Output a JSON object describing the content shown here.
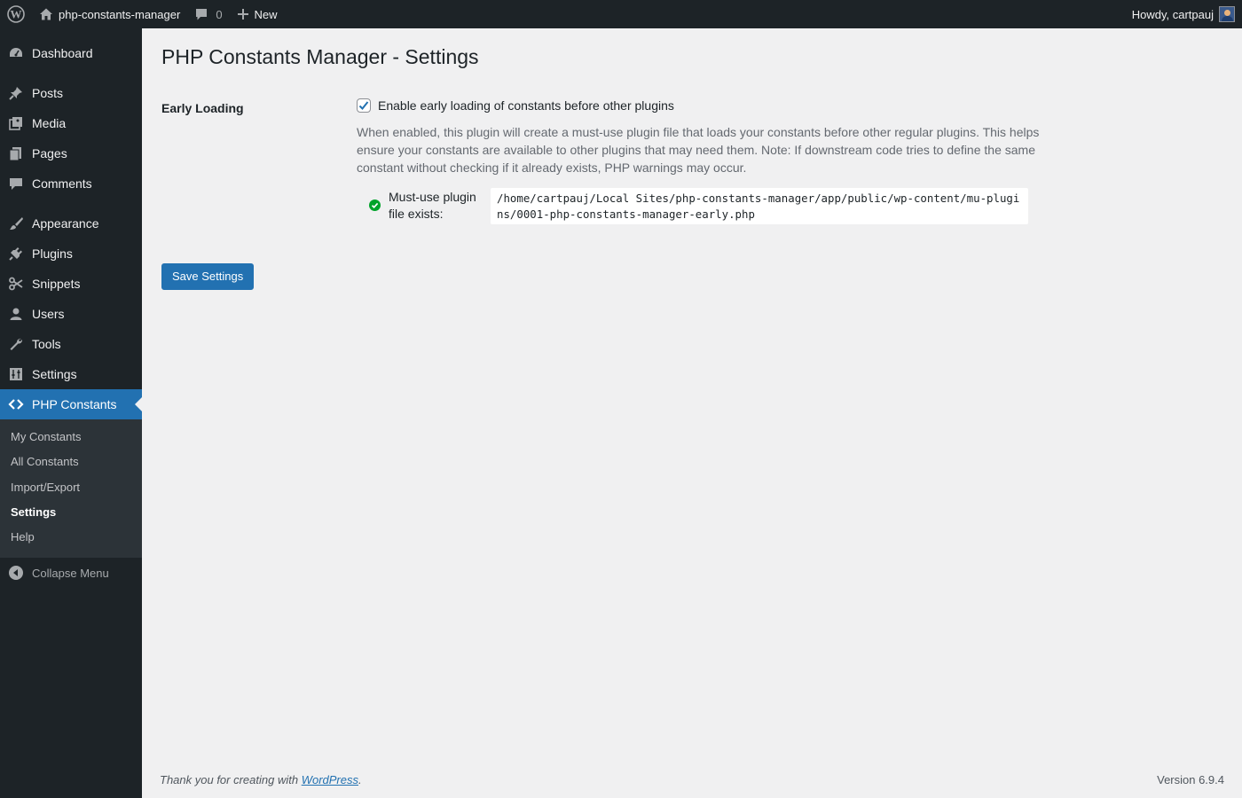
{
  "adminbar": {
    "site_name": "php-constants-manager",
    "comments_count": "0",
    "new_label": "New",
    "howdy": "Howdy, cartpauj"
  },
  "sidebar": {
    "items": [
      {
        "label": "Dashboard",
        "icon": "dashboard-icon"
      },
      {
        "label": "Posts",
        "icon": "pin-icon"
      },
      {
        "label": "Media",
        "icon": "media-icon"
      },
      {
        "label": "Pages",
        "icon": "pages-icon"
      },
      {
        "label": "Comments",
        "icon": "comment-icon"
      },
      {
        "label": "Appearance",
        "icon": "brush-icon"
      },
      {
        "label": "Plugins",
        "icon": "plug-icon"
      },
      {
        "label": "Snippets",
        "icon": "scissors-icon"
      },
      {
        "label": "Users",
        "icon": "user-icon"
      },
      {
        "label": "Tools",
        "icon": "wrench-icon"
      },
      {
        "label": "Settings",
        "icon": "sliders-icon"
      },
      {
        "label": "PHP Constants",
        "icon": "code-icon"
      }
    ],
    "submenu": [
      "My Constants",
      "All Constants",
      "Import/Export",
      "Settings",
      "Help"
    ],
    "collapse_label": "Collapse Menu"
  },
  "page": {
    "title": "PHP Constants Manager - Settings",
    "early_loading_label": "Early Loading",
    "checkbox_label": "Enable early loading of constants before other plugins",
    "checkbox_checked": true,
    "description": "When enabled, this plugin will create a must-use plugin file that loads your constants before other regular plugins. This helps ensure your constants are available to other plugins that may need them. Note: If downstream code tries to define the same constant without checking if it already exists, PHP warnings may occur.",
    "status_label": "Must-use plugin file exists:",
    "file_path": "/home/cartpauj/Local Sites/php-constants-manager/app/public/wp-content/mu-plugins/0001-php-constants-manager-early.php",
    "save_button": "Save Settings"
  },
  "footer": {
    "thanks_prefix": "Thank you for creating with ",
    "thanks_link": "WordPress",
    "thanks_suffix": ".",
    "version": "Version 6.9.4"
  },
  "colors": {
    "admin_dark": "#1d2327",
    "accent": "#2271b1",
    "success": "#00a32a"
  }
}
